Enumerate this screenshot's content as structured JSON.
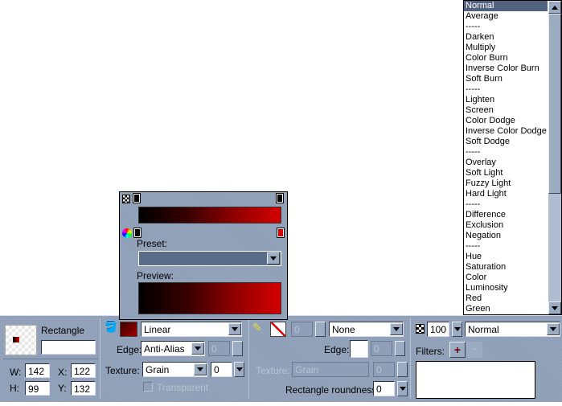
{
  "blend_list": {
    "items": [
      "Normal",
      "Average",
      "-----",
      "Darken",
      "Multiply",
      "Color Burn",
      "Inverse Color Burn",
      "Soft Burn",
      "-----",
      "Lighten",
      "Screen",
      "Color Dodge",
      "Inverse Color Dodge",
      "Soft Dodge",
      "-----",
      "Overlay",
      "Soft Light",
      "Fuzzy Light",
      "Hard Light",
      "-----",
      "Difference",
      "Exclusion",
      "Negation",
      "-----",
      "Hue",
      "Saturation",
      "Color",
      "Luminosity",
      "Red",
      "Green"
    ],
    "selected": "Normal"
  },
  "gradient_popup": {
    "preset_label": "Preset:",
    "preview_label": "Preview:",
    "preset_value": "",
    "colors": {
      "start": "#000000",
      "end": "#d40000"
    }
  },
  "object": {
    "type": "Rectangle",
    "name": "",
    "w_label": "W:",
    "w": "142",
    "h_label": "H:",
    "h": "99",
    "x_label": "X:",
    "x": "122",
    "y_label": "Y:",
    "y": "132"
  },
  "fill": {
    "color": "#8a0000",
    "type": "Linear",
    "edge_label": "Edge:",
    "edge": "Anti-Alias",
    "edge_amount": "0",
    "texture_label": "Texture:",
    "texture": "Grain",
    "texture_amount": "0",
    "transparent_label": "Transparent"
  },
  "stroke": {
    "size": "0",
    "type": "None",
    "edge_label": "Edge:",
    "edge_amount": "0",
    "texture_label": "Texture:",
    "texture": "Grain",
    "texture_amount": "0",
    "roundness_label": "Rectangle roundness:",
    "roundness": "0"
  },
  "effects": {
    "opacity": "100",
    "blend_mode": "Normal",
    "filters_label": "Filters:"
  }
}
